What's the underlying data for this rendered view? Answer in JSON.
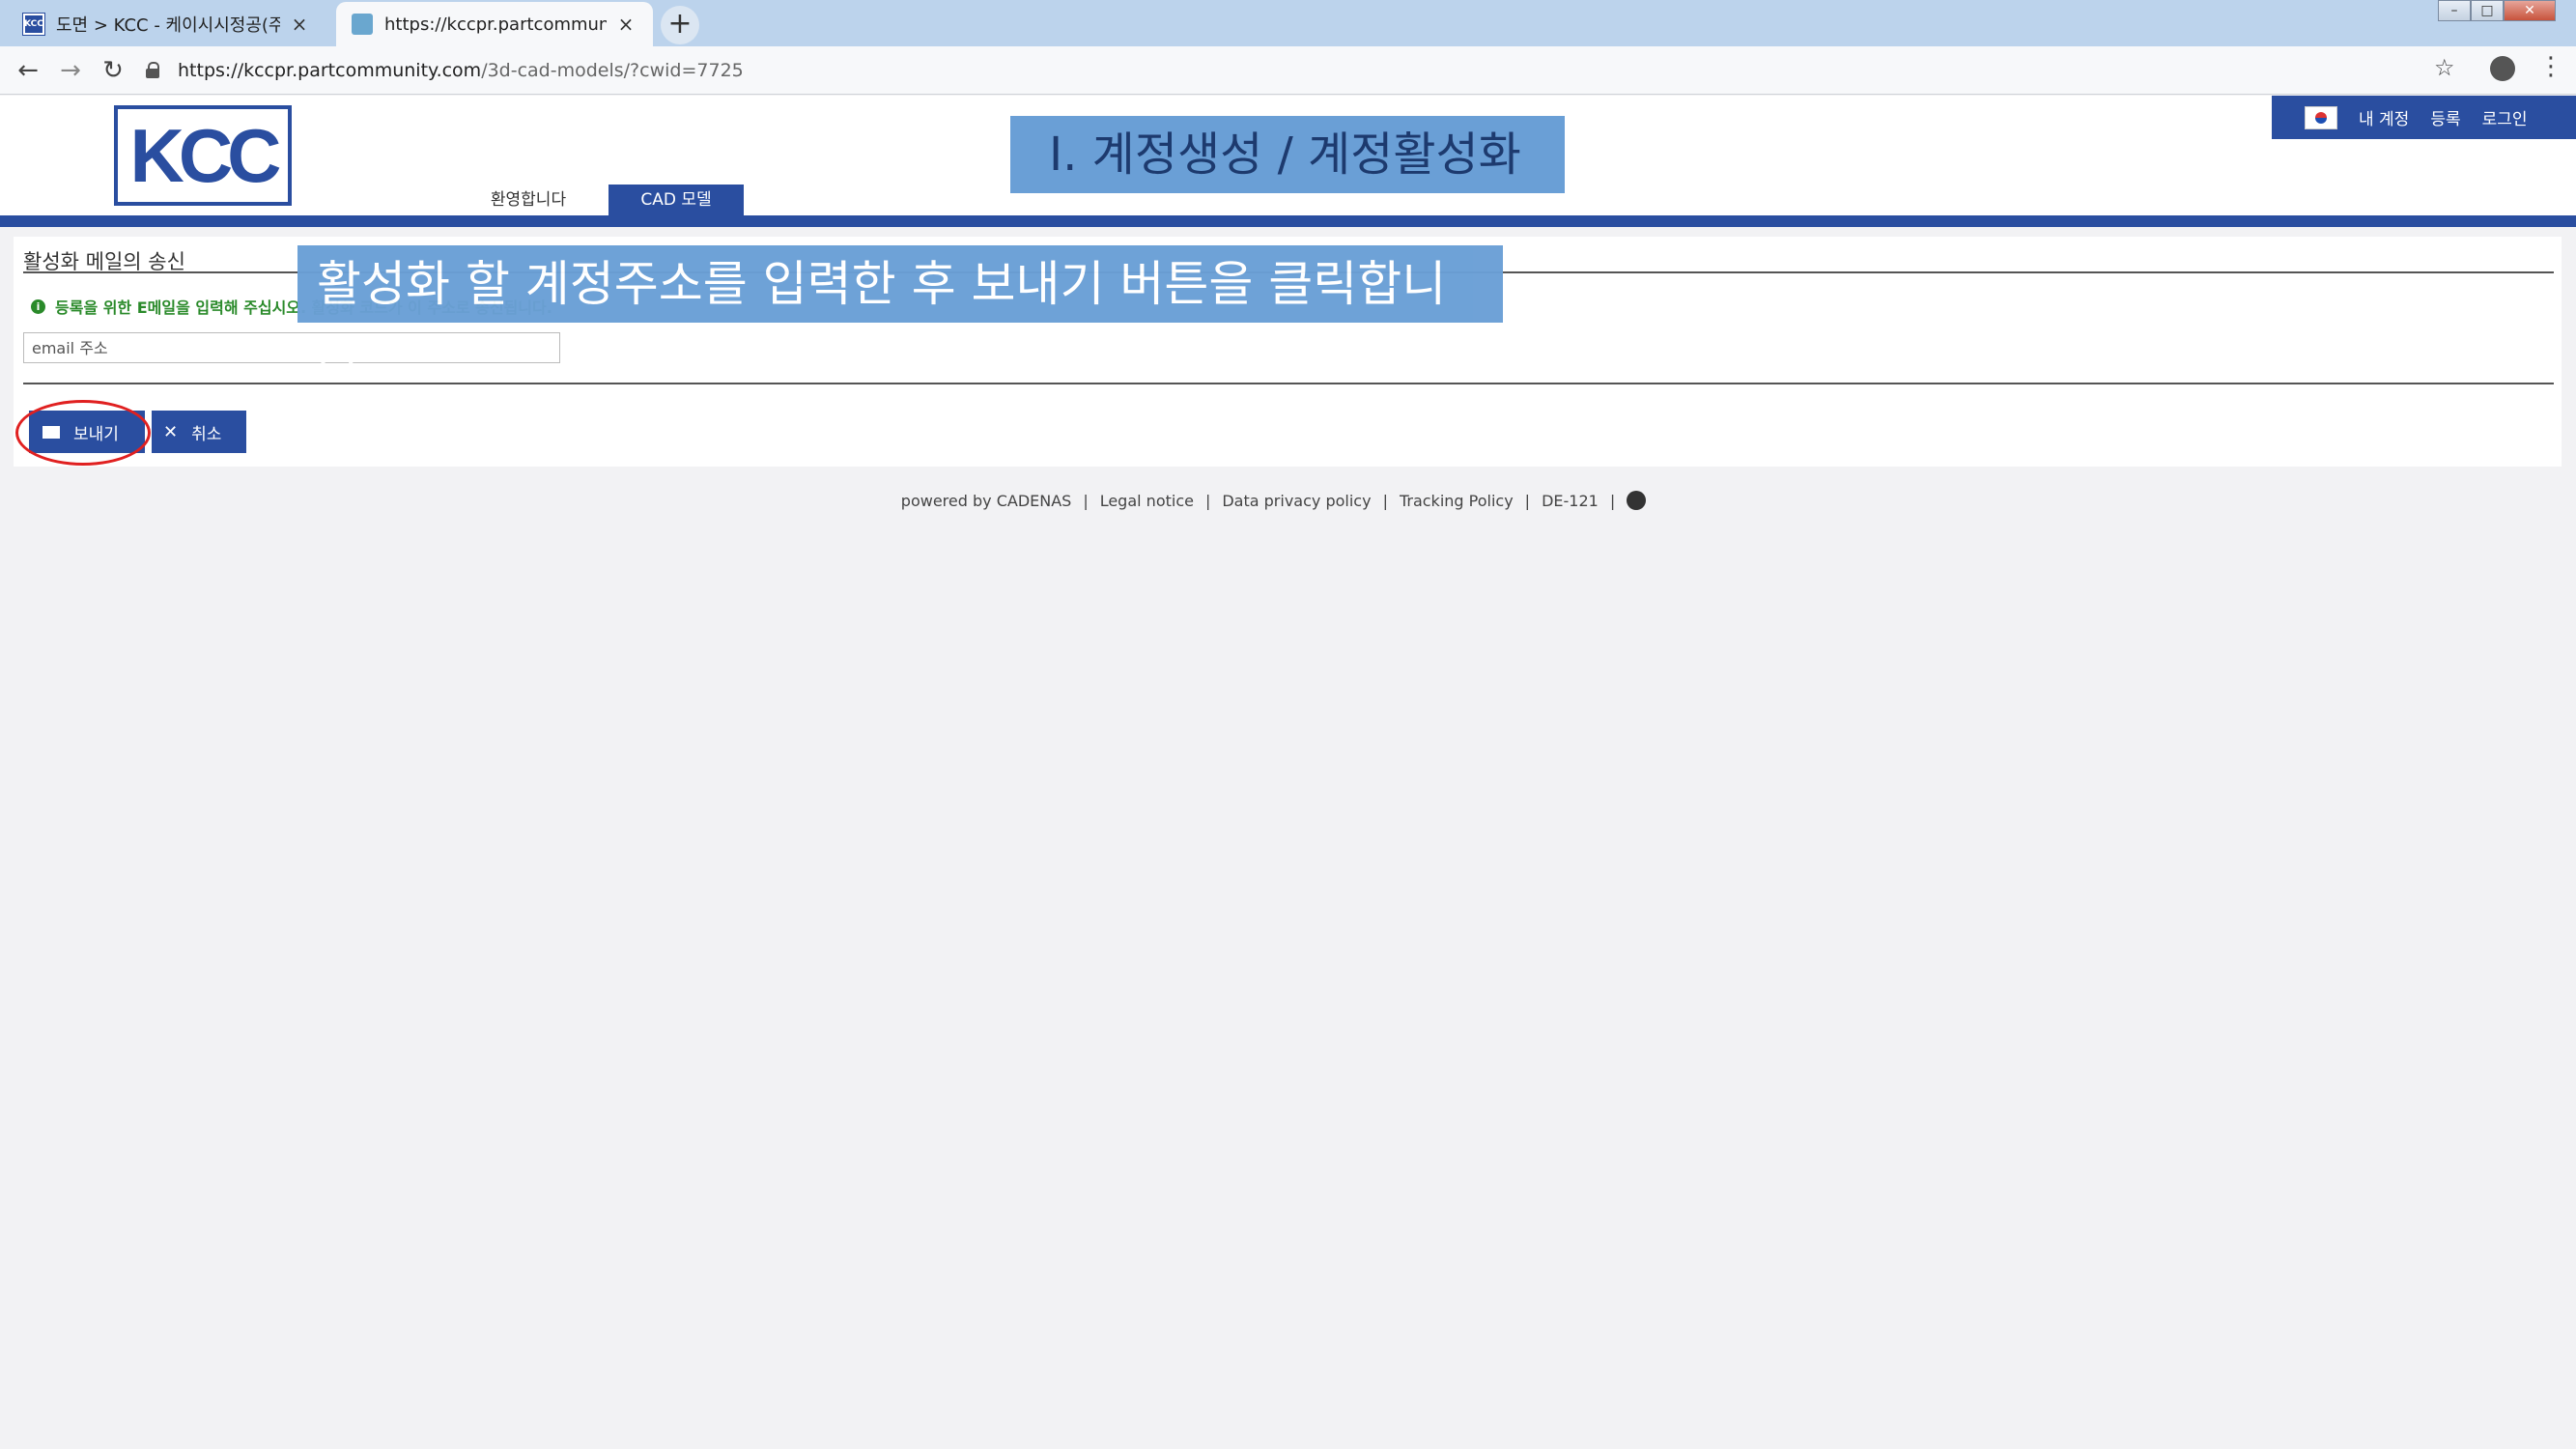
{
  "browser": {
    "tabs": [
      {
        "title": "도면 > KCC - 케이시시정공(주)",
        "favicon": "KCC"
      },
      {
        "title": "https://kccpr.partcommunity.com"
      }
    ],
    "new_tab": "+",
    "url_host": "https://kccpr.partcommunity.com",
    "url_path": "/3d-cad-models/?cwid=7725"
  },
  "header": {
    "logo_text": "KCC",
    "nav": {
      "welcome": "환영합니다",
      "cad": "CAD 모델"
    },
    "userbar": {
      "account": "내 계정",
      "register": "등록",
      "login": "로그인"
    }
  },
  "annotations": {
    "title_banner": "Ⅰ. 계정생성 / 계정활성화",
    "instruction_banner": "활성화 할 계정주소를 입력한 후 보내기 버튼을 클릭합니다."
  },
  "form": {
    "title": "활성화 메일의 송신",
    "info": "등록을 위한 E메일을 입력해 주십시오. 활성화 코드가 이 주소로 송신됩니다.",
    "email_placeholder": "email 주소",
    "send_label": "보내기",
    "cancel_label": "취소"
  },
  "footer": {
    "powered": "powered by CADENAS",
    "legal": "Legal notice",
    "privacy": "Data privacy policy",
    "tracking": "Tracking Policy",
    "code": "DE-121"
  }
}
